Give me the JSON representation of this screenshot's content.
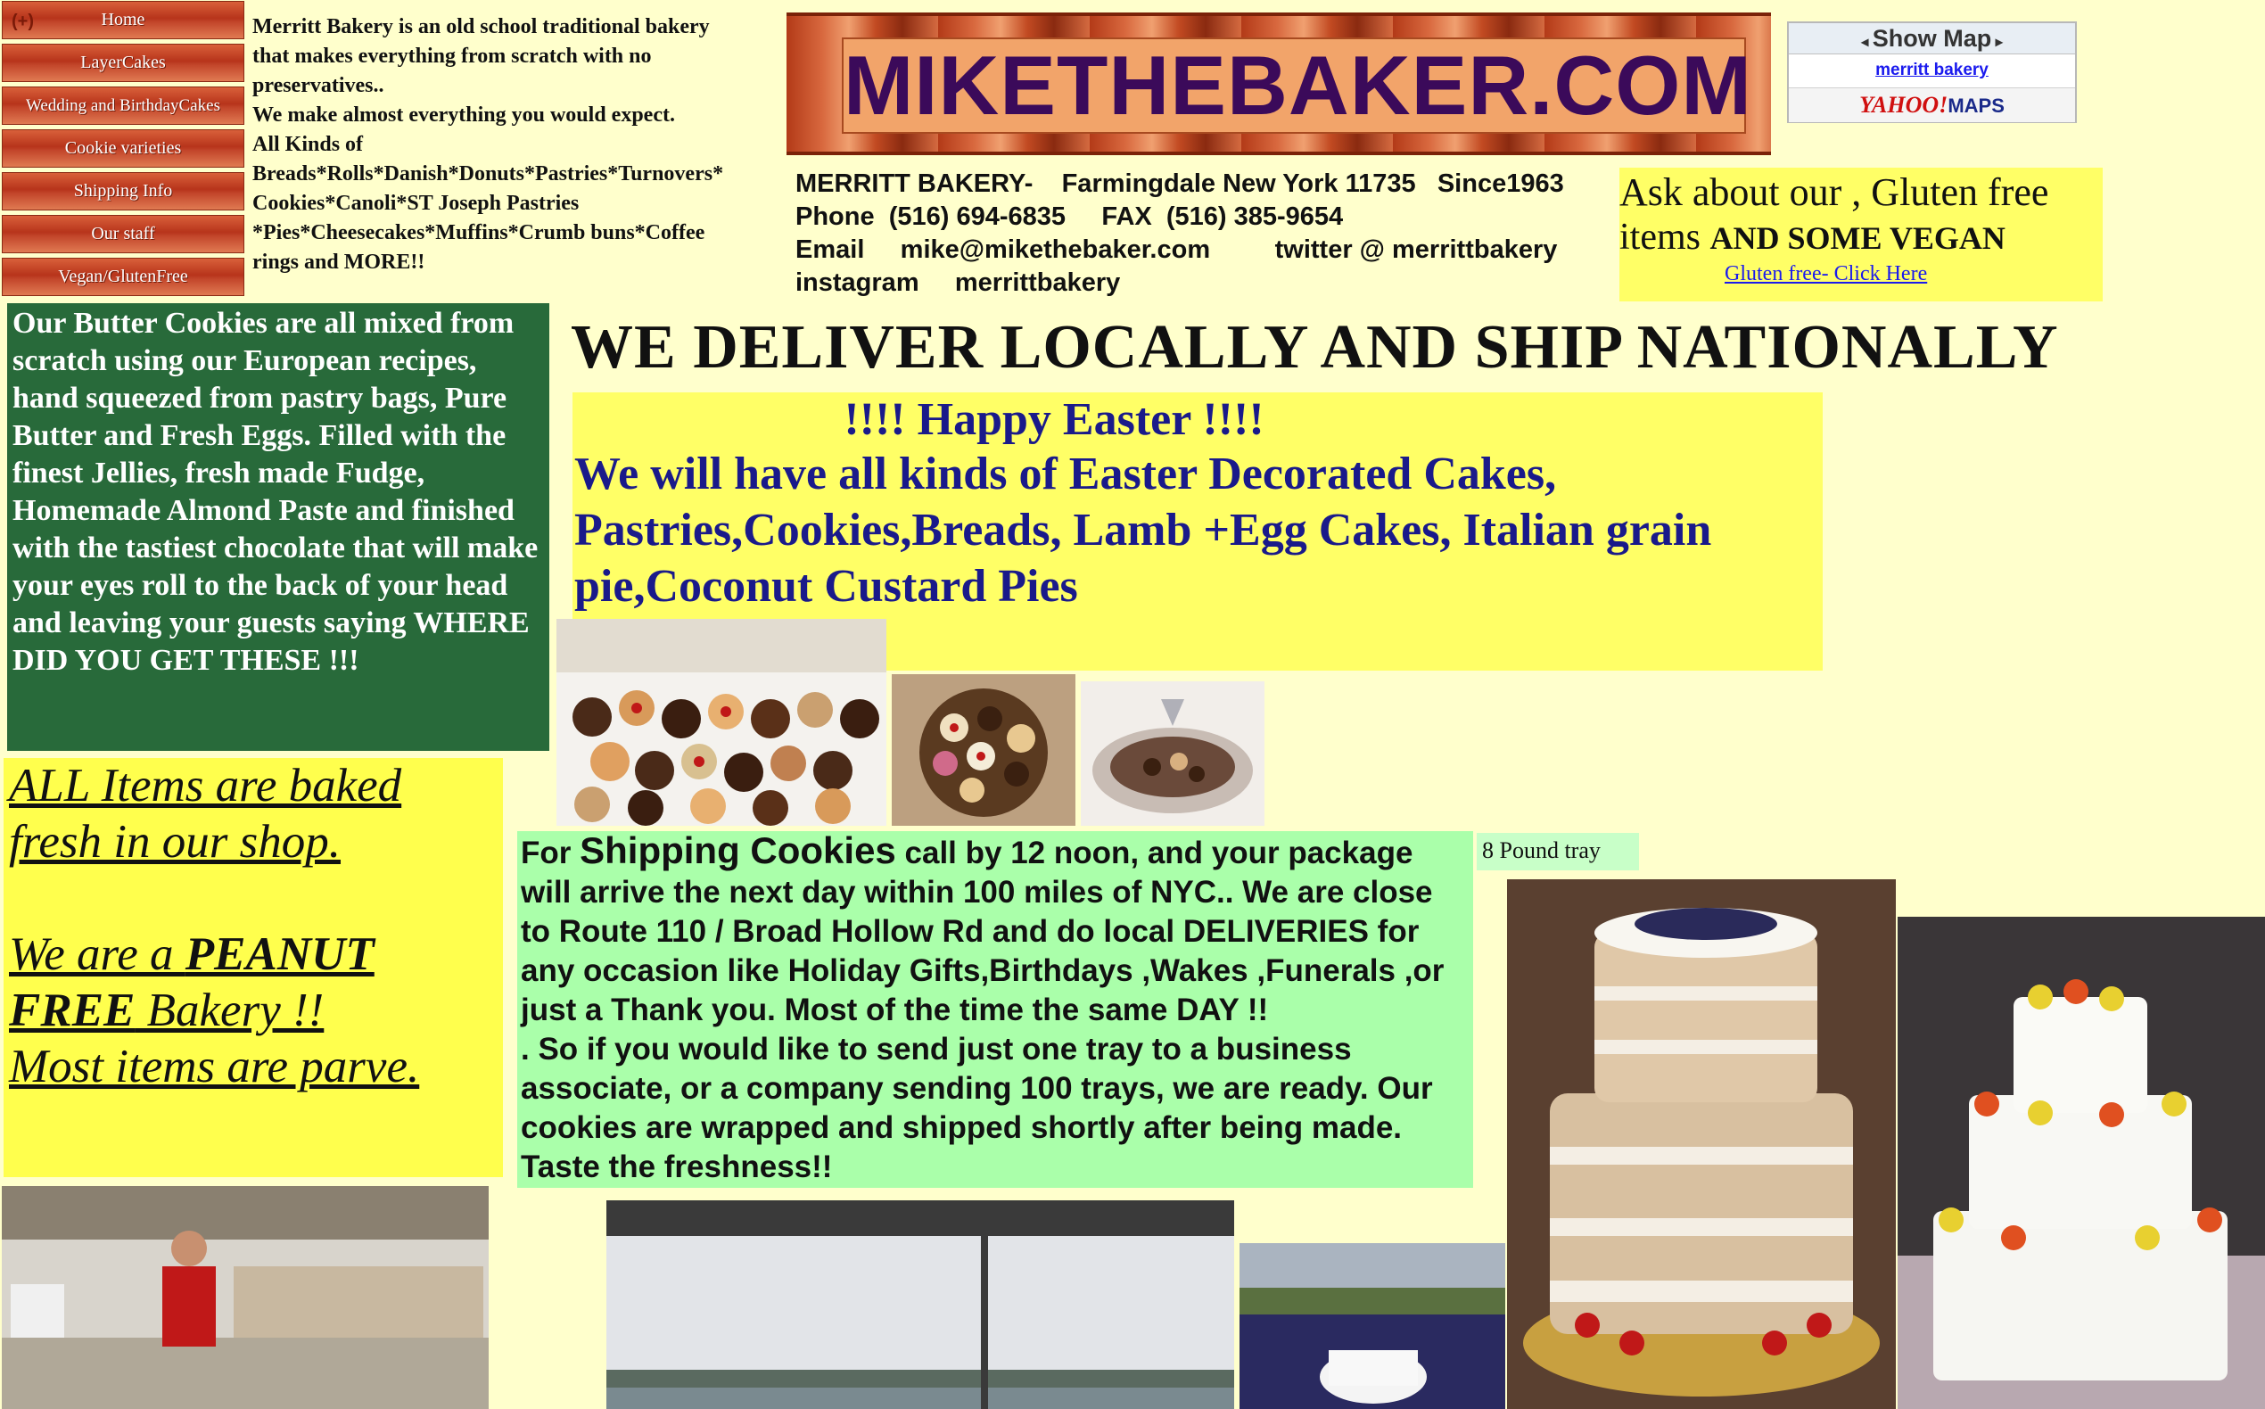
{
  "nav": {
    "items": [
      {
        "label": "Home"
      },
      {
        "label": "LayerCakes"
      },
      {
        "label": "Wedding and BirthdayCakes"
      },
      {
        "label": "Cookie varieties"
      },
      {
        "label": "Shipping Info"
      },
      {
        "label": "Our staff"
      },
      {
        "label": "Vegan/GlutenFree"
      }
    ],
    "plus_icon": "(+)"
  },
  "intro": {
    "lines": [
      "Merritt Bakery is an old school traditional bakery",
      "that makes everything from scratch with no",
      "preservatives..",
      "We make almost everything you would expect.",
      "All Kinds of",
      "Breads*Rolls*Danish*Donuts*Pastries*Turnovers*",
      "Cookies*Canoli*ST Joseph Pastries",
      "*Pies*Cheesecakes*Muffins*Crumb buns*Coffee",
      "rings and MORE!!"
    ]
  },
  "logo": {
    "text": "MIKETHEBAKER.COM"
  },
  "map": {
    "show_map": "Show Map",
    "link": "merritt bakery",
    "yahoo": "YAHOO!",
    "maps": "MAPS"
  },
  "contact": {
    "line1": "MERRITT BAKERY-    Farmingdale New York 11735   Since1963",
    "line2": "Phone  (516) 694-6835     FAX  (516) 385-9654",
    "line3": "Email     mike@mikethebaker.com         twitter @ merrittbakery",
    "line4": "instagram     merrittbakery"
  },
  "gluten": {
    "line1": "Ask about our , Gluten free",
    "line2_pre": "items ",
    "line2_bold": "AND SOME  VEGAN",
    "link": "Gluten free- Click Here"
  },
  "butter": {
    "text": "Our Butter Cookies are all mixed from scratch using our European recipes, hand squeezed from pastry bags, Pure Butter and Fresh Eggs. Filled with the finest Jellies, fresh made Fudge, Homemade Almond Paste and finished  with the tastiest chocolate that will make your eyes roll to the back of your head and leaving your guests saying WHERE DID YOU GET THESE !!!"
  },
  "deliver": {
    "text": "WE DELIVER   LOCALLY AND SHIP NATIONALLY"
  },
  "easter": {
    "head": "!!!!  Happy Easter !!!!",
    "body": "We will have all kinds of Easter Decorated Cakes, Pastries,Cookies,Breads, Lamb  +Egg Cakes, Italian grain pie,Coconut Custard Pies"
  },
  "allitems": {
    "line1": "ALL Items are baked",
    "line2": "fresh in our shop.",
    "line3_pre": "We are a ",
    "line3_bold": "PEANUT",
    "line4_bold": "FREE",
    "line4_rest": " Bakery !!",
    "line5": "Most items are parve."
  },
  "shipping": {
    "pre": "For ",
    "big": "Shipping Cookies",
    "rest": " call by 12 noon, and your package will arrive the next day within 100 miles of NYC.. We are close to Route 110 / Broad Hollow Rd and do local DELIVERIES for any occasion like Holiday Gifts,Birthdays ,Wakes ,Funerals ,or just a Thank you. Most of the time the same DAY !!",
    "p2": ". So if you would like to send just one tray to a business associate, or a company sending 100  trays, we are ready. Our cookies are wrapped and shipped shortly after being made. Taste the freshness!!"
  },
  "pound_tray": "8  Pound tray"
}
